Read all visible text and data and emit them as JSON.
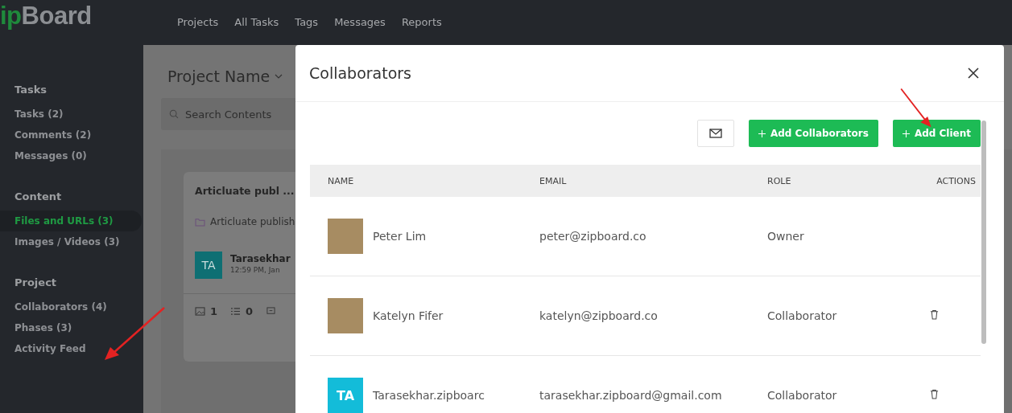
{
  "logo": {
    "accent": "ip",
    "rest": "Board"
  },
  "nav": [
    "Projects",
    "All Tasks",
    "Tags",
    "Messages",
    "Reports"
  ],
  "sidebar": [
    {
      "heading": "Tasks",
      "items": [
        {
          "label": "Tasks (2)",
          "selected": false
        },
        {
          "label": "Comments (2)",
          "selected": false
        },
        {
          "label": "Messages (0)",
          "selected": false
        }
      ]
    },
    {
      "heading": "Content",
      "items": [
        {
          "label": "Files and URLs (3)",
          "selected": true
        },
        {
          "label": "Images / Videos (3)",
          "selected": false
        }
      ]
    },
    {
      "heading": "Project",
      "items": [
        {
          "label": "Collaborators (4)",
          "selected": false
        },
        {
          "label": "Phases (3)",
          "selected": false
        },
        {
          "label": "Activity Feed",
          "selected": false
        }
      ]
    }
  ],
  "project": {
    "title": "Project Name",
    "search": {
      "placeholder": "Search Contents"
    },
    "card": {
      "title": "Articluate publ ...",
      "folder": "Articluate publish",
      "author": {
        "initials": "TA",
        "name": "Tarasekhar",
        "time": "12:59 PM, Jan"
      },
      "stats": [
        "1",
        "0"
      ]
    }
  },
  "modal": {
    "title": "Collaborators",
    "buttons": [
      "Add Collaborators",
      "Add Client"
    ],
    "table": {
      "columns": [
        "NAME",
        "EMAIL",
        "ROLE",
        "ACTIONS"
      ],
      "rows": [
        {
          "kind": "photo",
          "name": "Peter Lim",
          "email": "peter@zipboard.co",
          "role": "Owner",
          "deletable": false
        },
        {
          "kind": "photo",
          "name": "Katelyn Fifer",
          "email": "katelyn@zipboard.co",
          "role": "Collaborator",
          "deletable": true
        },
        {
          "kind": "initials",
          "initials": "TA",
          "name": "Tarasekhar.zipboarc",
          "email": "tarasekhar.zipboard@gmail.com",
          "role": "Collaborator",
          "deletable": true
        }
      ]
    }
  }
}
